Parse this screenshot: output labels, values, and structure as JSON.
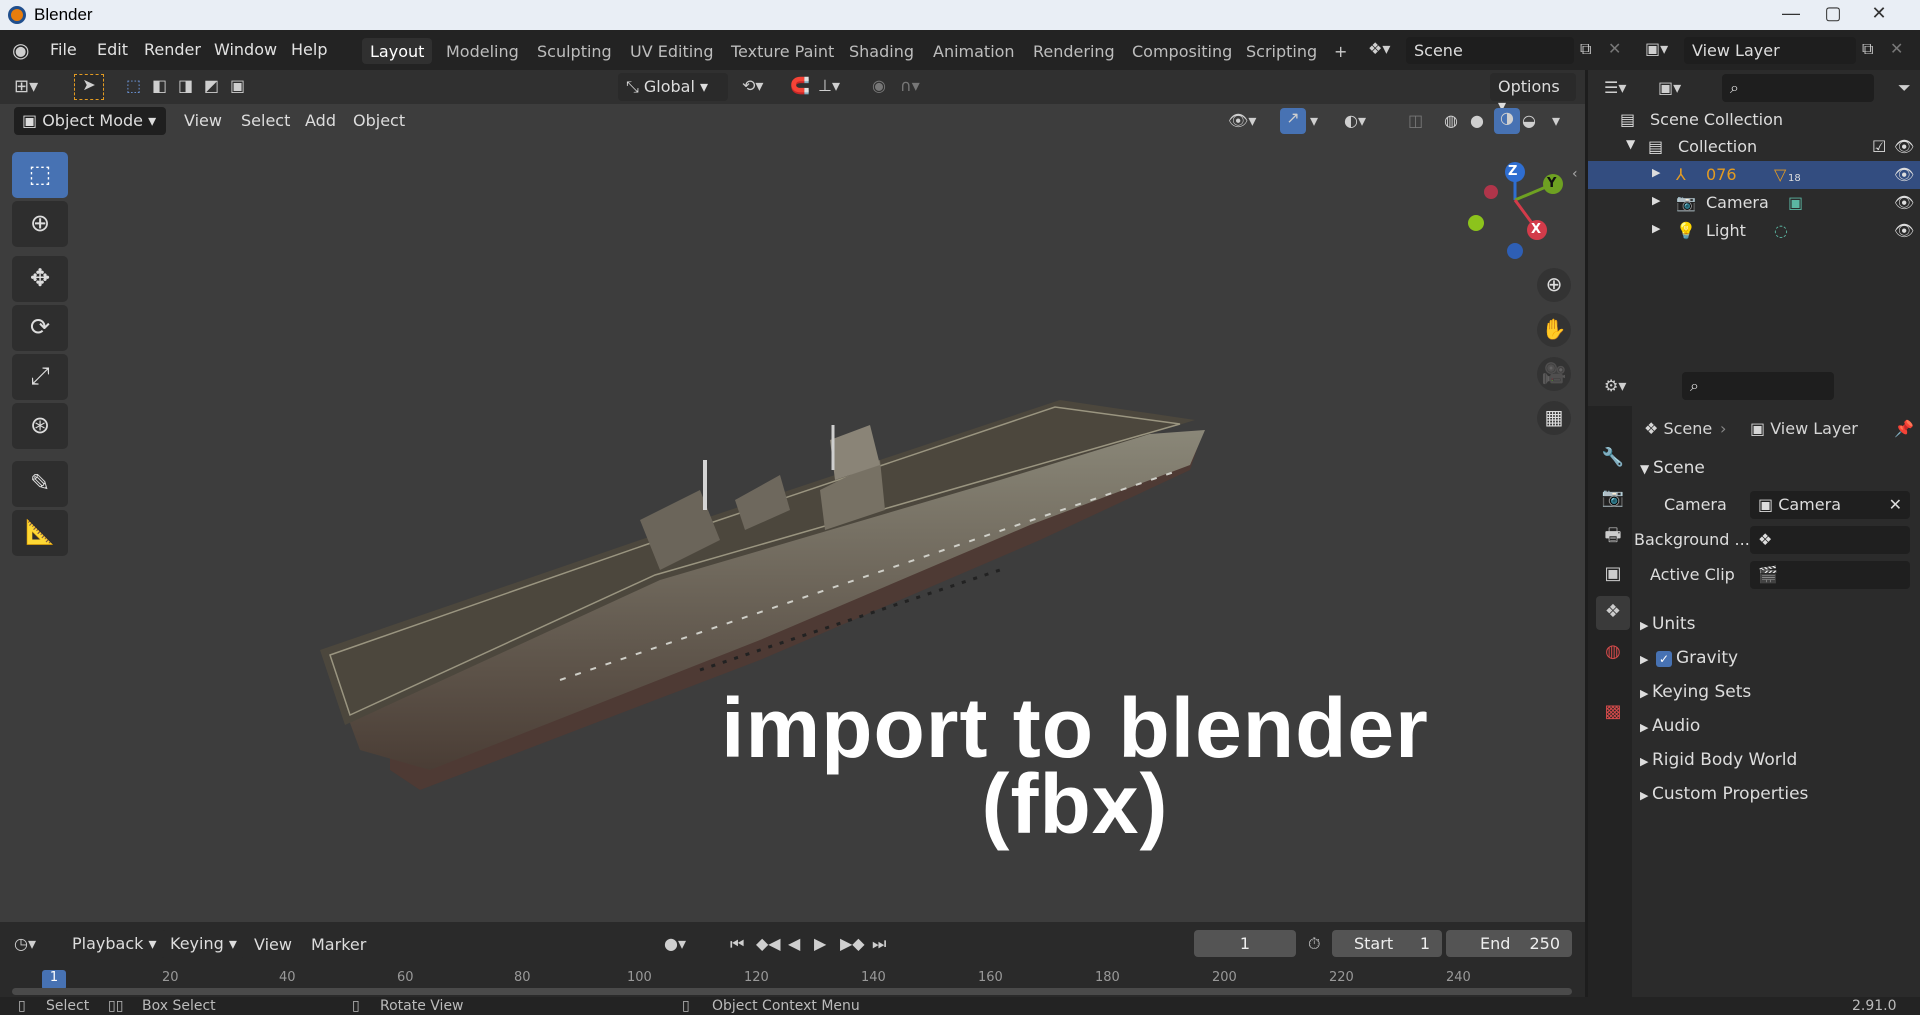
{
  "window": {
    "title": "Blender",
    "min": "—",
    "max": "▢",
    "close": "✕"
  },
  "menu": [
    "File",
    "Edit",
    "Render",
    "Window",
    "Help"
  ],
  "workspaces": [
    "Layout",
    "Modeling",
    "Sculpting",
    "UV Editing",
    "Texture Paint",
    "Shading",
    "Animation",
    "Rendering",
    "Compositing",
    "Scripting"
  ],
  "add_workspace": "+",
  "scene": {
    "label": "Scene"
  },
  "view_layer": {
    "label": "View Layer"
  },
  "header1": {
    "transform": "Global",
    "options": "Options"
  },
  "header2": {
    "mode": "Object Mode",
    "view": "View",
    "select": "Select",
    "add": "Add",
    "object": "Object"
  },
  "gizmo": {
    "z": "Z",
    "y": "Y",
    "x": "X"
  },
  "overlay": {
    "line1": "import to blender",
    "line2": "(fbx)"
  },
  "timeline": {
    "playback": "Playback",
    "keying": "Keying",
    "view": "View",
    "marker": "Marker",
    "current_frame": "1",
    "start_label": "Start",
    "start": "1",
    "end_label": "End",
    "end": "250",
    "ticks": [
      "1",
      "20",
      "40",
      "60",
      "80",
      "100",
      "120",
      "140",
      "160",
      "180",
      "200",
      "220",
      "240"
    ]
  },
  "outliner": {
    "root": "Scene Collection",
    "collection": "Collection",
    "items": [
      {
        "name": "076",
        "badge": "18"
      },
      {
        "name": "Camera"
      },
      {
        "name": "Light"
      }
    ]
  },
  "properties": {
    "breadcrumb_scene": "Scene",
    "breadcrumb_layer": "View Layer",
    "section": "Scene",
    "camera_label": "Camera",
    "camera_value": "Camera",
    "background_label": "Background ...",
    "clip_label": "Active Clip",
    "panels": [
      "Units",
      "Gravity",
      "Keying Sets",
      "Audio",
      "Rigid Body World",
      "Custom Properties"
    ]
  },
  "status": {
    "select": "Select",
    "box_select": "Box Select",
    "rotate": "Rotate View",
    "context": "Object Context Menu",
    "version": "2.91.0"
  }
}
